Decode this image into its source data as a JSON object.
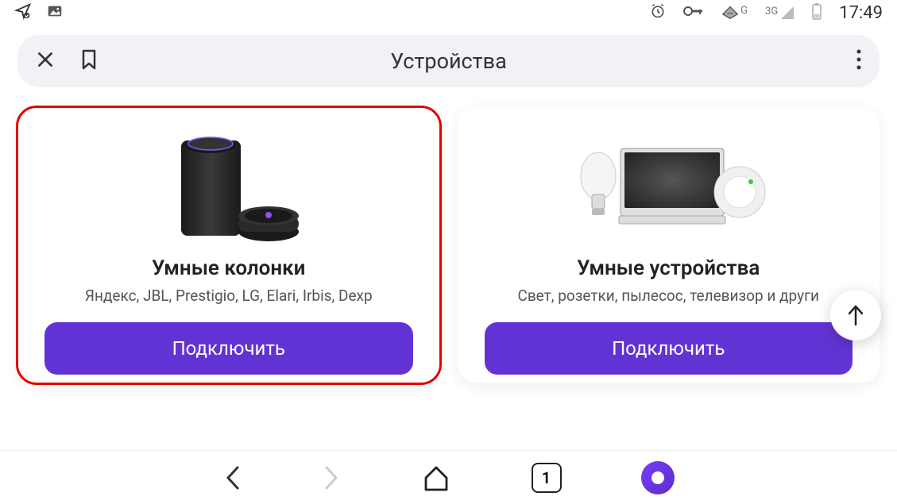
{
  "status": {
    "network1": "G",
    "network2": "3G",
    "time": "17:49"
  },
  "header": {
    "title": "Устройства"
  },
  "cards": [
    {
      "title": "Умные колонки",
      "subtitle": "Яндекс, JBL, Prestigio, LG, Elari, Irbis, Dexp",
      "button": "Подключить"
    },
    {
      "title": "Умные устройства",
      "subtitle": "Свет, розетки, пылесос, телевизор и други",
      "button": "Подключить"
    }
  ],
  "nav": {
    "tabs_count": "1"
  }
}
